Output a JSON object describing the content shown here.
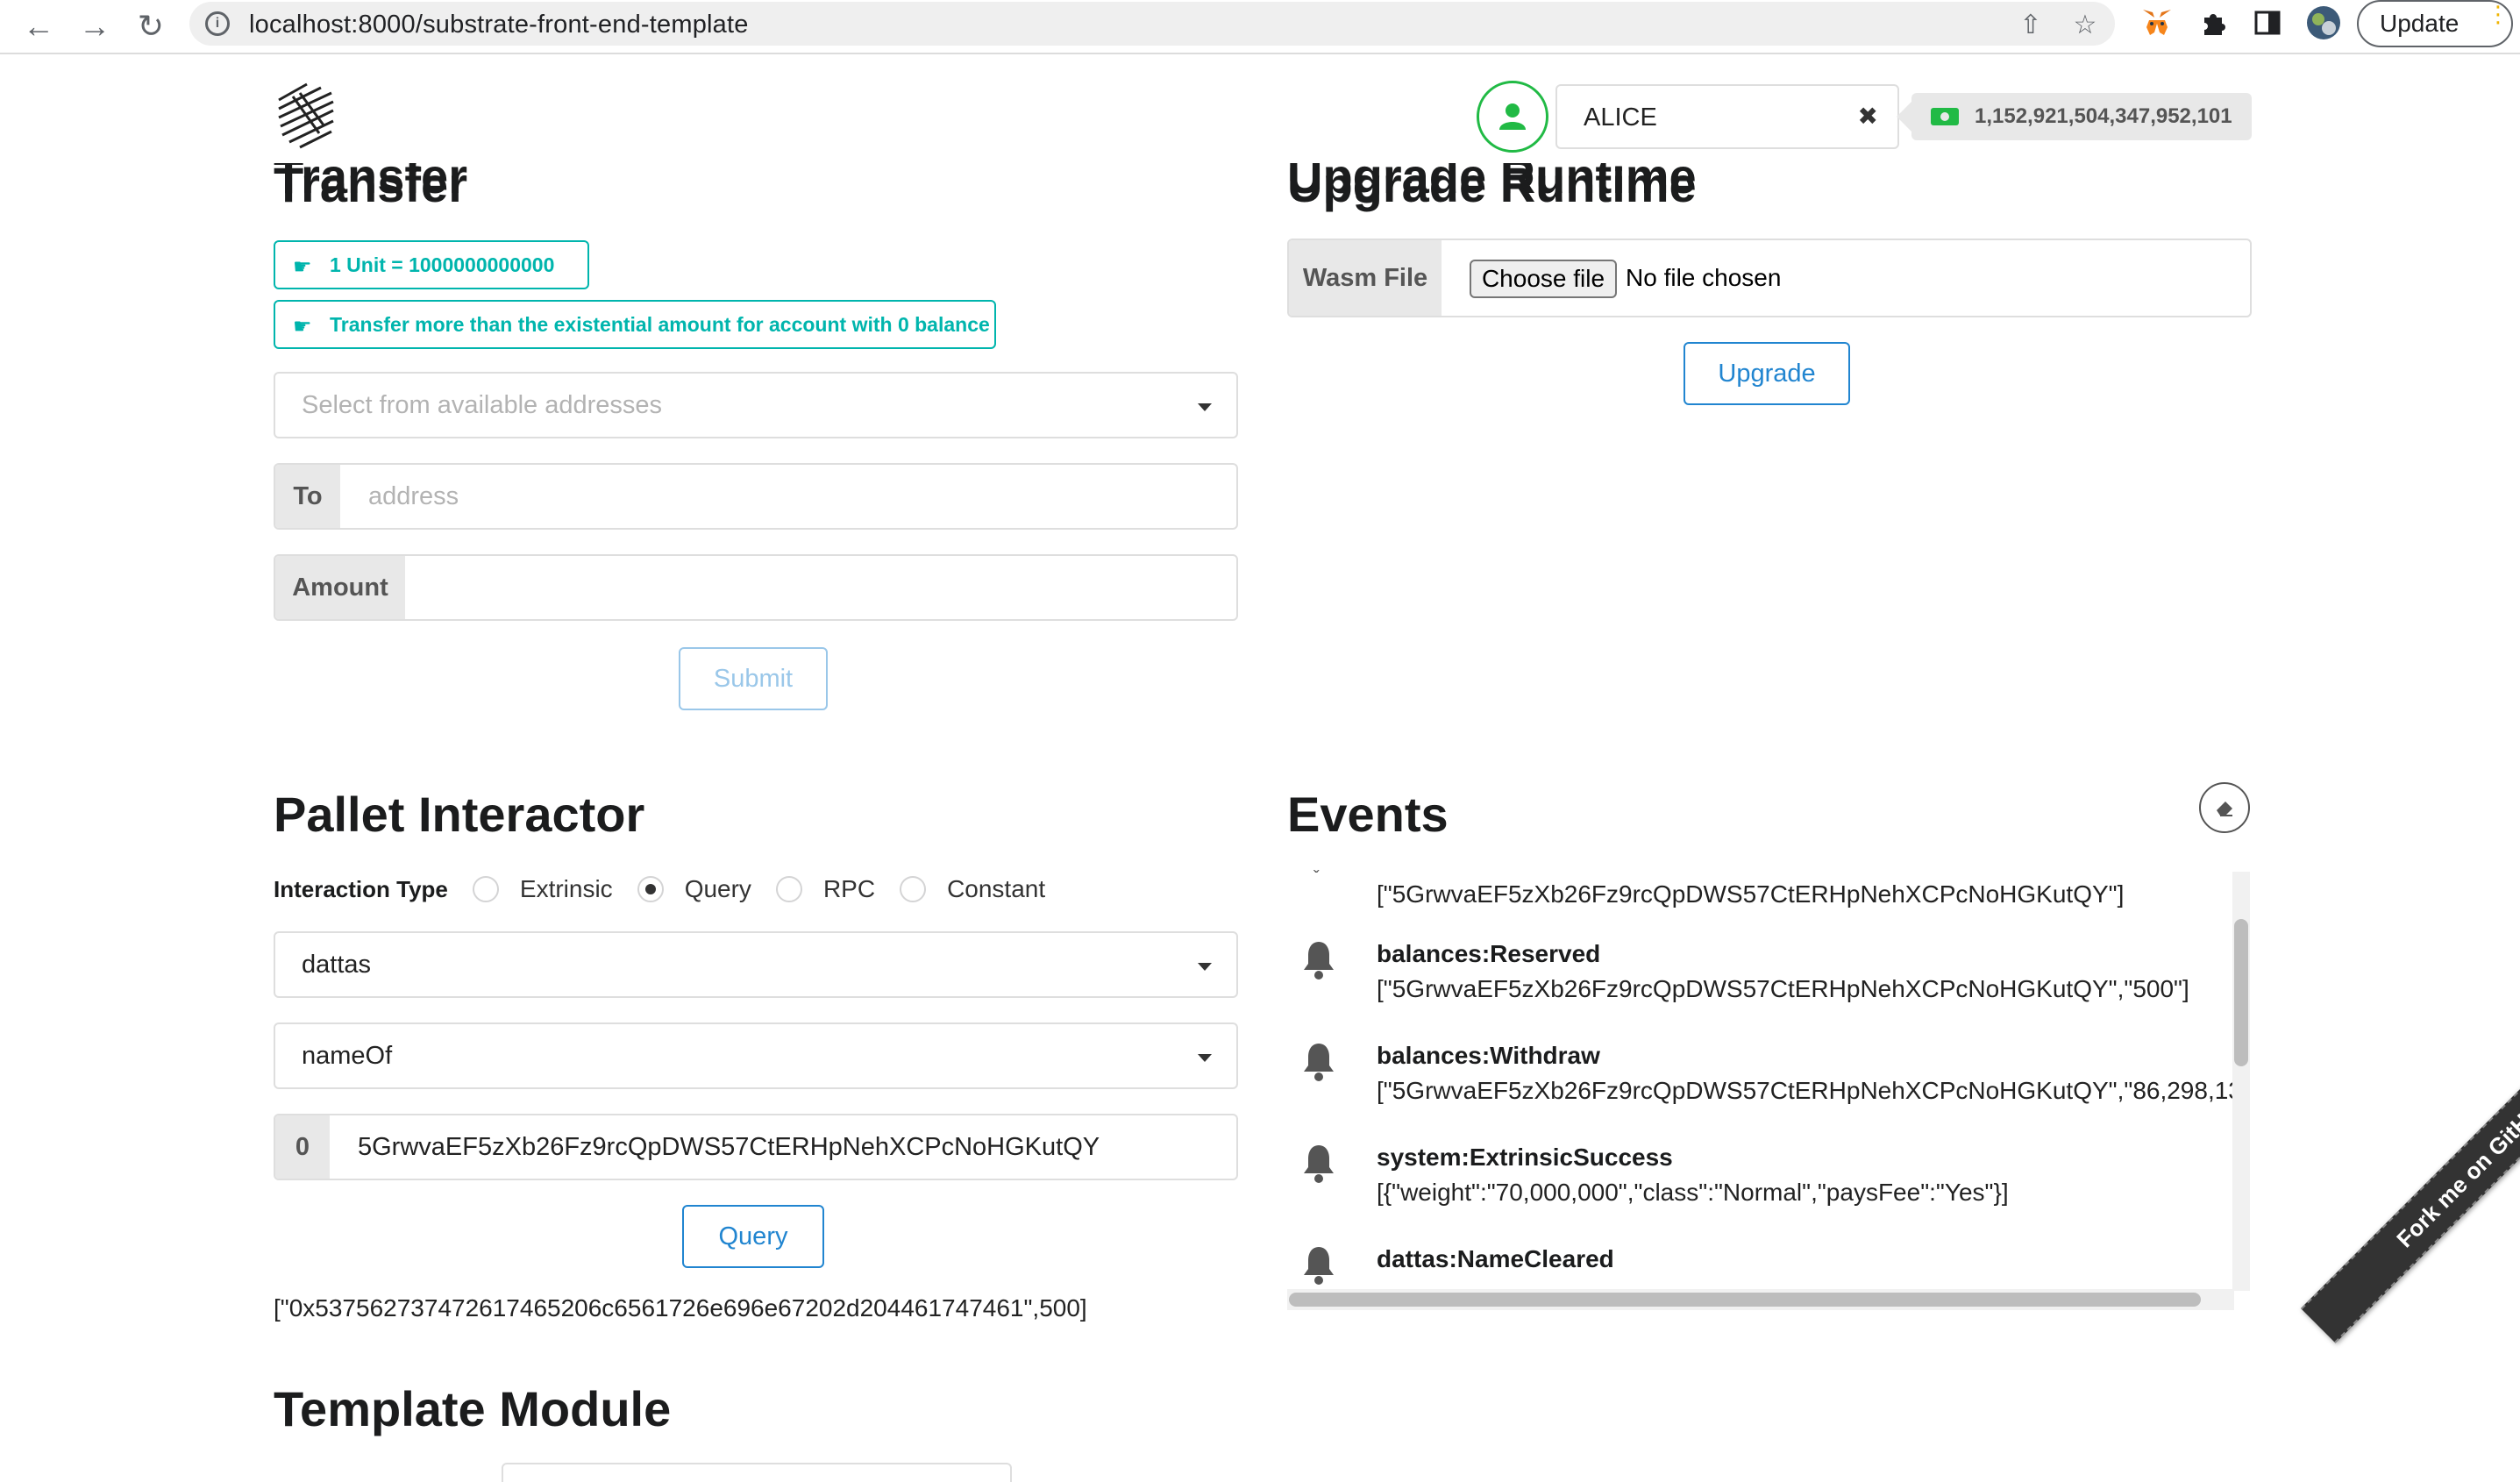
{
  "browser": {
    "url": "localhost:8000/substrate-front-end-template",
    "update_label": "Update"
  },
  "header": {
    "account_name": "ALICE",
    "balance": "1,152,921,504,347,952,101"
  },
  "transfer": {
    "title": "Transfer",
    "unit_note": "1 Unit = 1000000000000",
    "existential_note": "Transfer more than the existential amount for account with 0 balance",
    "address_dropdown_placeholder": "Select from available addresses",
    "to_label": "To",
    "to_placeholder": "address",
    "amount_label": "Amount",
    "amount_value": "",
    "submit_label": "Submit"
  },
  "upgrade": {
    "title": "Upgrade Runtime",
    "wasm_label": "Wasm File",
    "choose_file_label": "Choose file",
    "no_file_text": "No file chosen",
    "upgrade_label": "Upgrade"
  },
  "pallet": {
    "title": "Pallet Interactor",
    "interaction_type_label": "Interaction Type",
    "interaction_types": [
      {
        "label": "Extrinsic",
        "selected": false
      },
      {
        "label": "Query",
        "selected": true
      },
      {
        "label": "RPC",
        "selected": false
      },
      {
        "label": "Constant",
        "selected": false
      }
    ],
    "pallet_value": "dattas",
    "callable_value": "nameOf",
    "param_index": "0",
    "param_value": "5GrwvaEF5zXb26Fz9rcQpDWS57CtERHpNehXCPcNoHGKutQY",
    "query_label": "Query",
    "result": "[\"0x537562737472617465206c6561726e696e67202d204461747461\",500]"
  },
  "events": {
    "title": "Events",
    "partial_top_data": "[\"5GrwvaEF5zXb26Fz9rcQpDWS57CtERHpNehXCPcNoHGKutQY\"]",
    "items": [
      {
        "name": "balances:Reserved",
        "data": "[\"5GrwvaEF5zXb26Fz9rcQpDWS57CtERHpNehXCPcNoHGKutQY\",\"500\"]"
      },
      {
        "name": "balances:Withdraw",
        "data": "[\"5GrwvaEF5zXb26Fz9rcQpDWS57CtERHpNehXCPcNoHGKutQY\",\"86,298,13"
      },
      {
        "name": "system:ExtrinsicSuccess",
        "data": "[{\"weight\":\"70,000,000\",\"class\":\"Normal\",\"paysFee\":\"Yes\"}]"
      },
      {
        "name": "dattas:NameCleared",
        "data": ""
      }
    ]
  },
  "template_module": {
    "title": "Template Module"
  },
  "ribbon": {
    "text": "Fork me on GitHub"
  },
  "colors": {
    "teal": "#00b5ad",
    "primary_blue": "#2185d0",
    "green": "#21ba45"
  }
}
